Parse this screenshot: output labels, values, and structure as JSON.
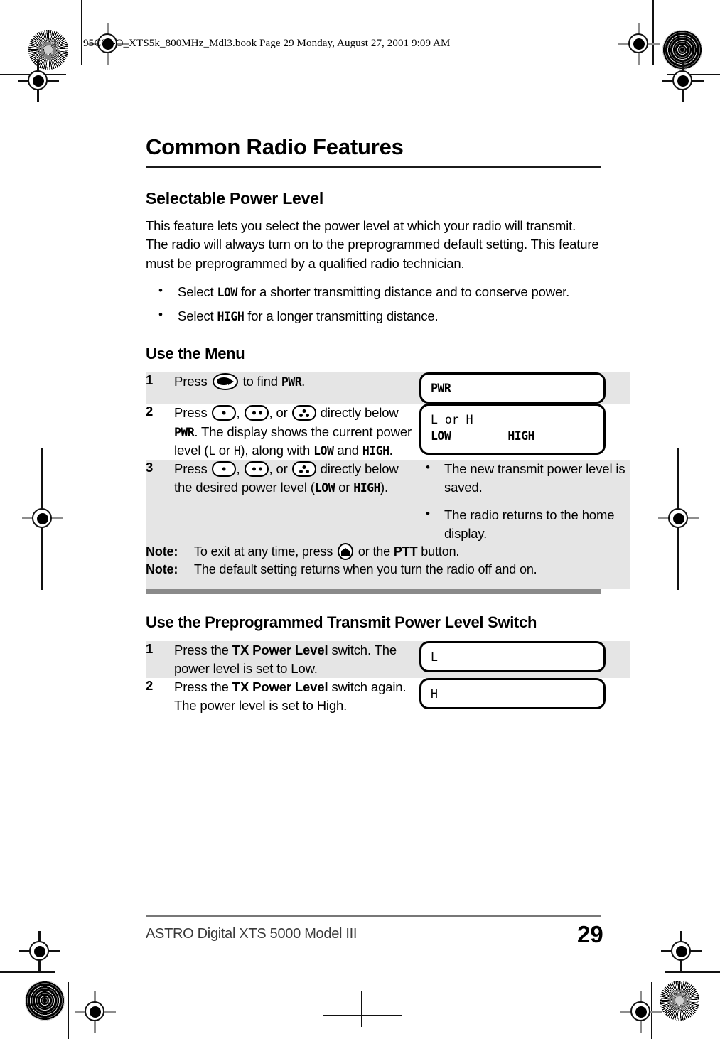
{
  "slug": "95C08-O_XTS5k_800MHz_Mdl3.book  Page 29  Monday, August 27, 2001  9:09 AM",
  "chapter_title": "Common Radio Features",
  "section": {
    "title": "Selectable Power Level",
    "intro": "This feature lets you select the power level at which your radio will transmit. The radio will always turn on to the preprogrammed default setting. This feature must be preprogrammed by a qualified radio technician.",
    "bullets": [
      {
        "pre": "Select ",
        "code": "LOW",
        "post": " for a shorter transmitting distance and to conserve power."
      },
      {
        "pre": "Select ",
        "code": "HIGH",
        "post": " for a longer transmitting distance."
      }
    ]
  },
  "menu_procedure": {
    "heading": "Use the Menu",
    "steps": [
      {
        "num": "1",
        "text_a": "Press ",
        "icon": "menu-select-key",
        "text_b": " to find ",
        "code": "PWR",
        "text_c": ".",
        "display": {
          "line1": "PWR"
        }
      },
      {
        "num": "2",
        "text_a": "Press ",
        "text_b": ", ",
        "text_c": ", or ",
        "text_d": " directly below ",
        "code_pwr": "PWR",
        "text_e": ". The display shows the current power level (",
        "code_l": "L",
        "text_or": " or ",
        "code_h": "H",
        "text_f": "), along with ",
        "code_low": "LOW",
        "text_and": " and ",
        "code_high": "HIGH",
        "text_g": ".",
        "display": {
          "line1": "L or H",
          "line2_left": "LOW",
          "line2_right": "HIGH"
        }
      },
      {
        "num": "3",
        "text_a": "Press ",
        "text_b": ", ",
        "text_c": ", or ",
        "text_d": " directly below the desired power level (",
        "code_low": "LOW",
        "text_or": " or ",
        "code_high": "HIGH",
        "text_e": ").",
        "results": [
          "The new transmit power level is saved.",
          "The radio returns to the home display."
        ]
      }
    ],
    "notes": [
      {
        "label": "Note:",
        "text_a": "To exit at any time, press ",
        "icon": "home-key",
        "text_b": " or the ",
        "bold": "PTT",
        "text_c": " button."
      },
      {
        "label": "Note:",
        "text_a": "The default setting returns when you turn the radio off and on.",
        "icon": null,
        "text_b": "",
        "bold": "",
        "text_c": ""
      }
    ]
  },
  "switch_procedure": {
    "heading": "Use the Preprogrammed Transmit Power Level Switch",
    "steps": [
      {
        "num": "1",
        "text_a": "Press the ",
        "bold": "TX Power Level",
        "text_b": " switch. The power level is set to Low.",
        "display": {
          "line1": "L"
        }
      },
      {
        "num": "2",
        "text_a": "Press the ",
        "bold": "TX Power Level",
        "text_b": " switch again. The power level is set to High.",
        "display": {
          "line1": "H"
        }
      }
    ]
  },
  "footer": {
    "left": "ASTRO Digital XTS 5000 Model III",
    "page": "29"
  },
  "colors": {
    "row_shade": "#e5e5e5",
    "table_rule": "#8a8a8a",
    "chapter_rule": "#1b1b1b",
    "footer_rule": "#777777"
  }
}
